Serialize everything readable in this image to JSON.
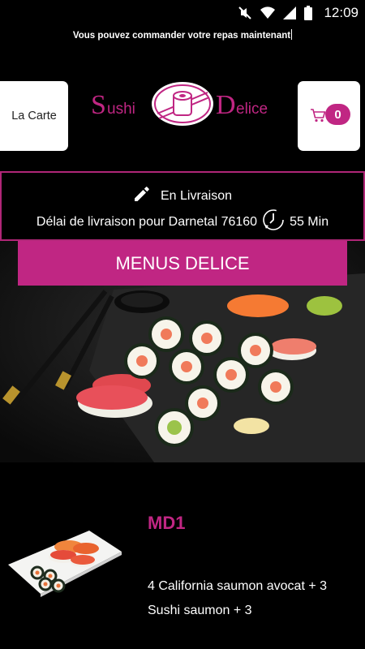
{
  "status_bar": {
    "time": "12:09"
  },
  "promo_text": "Vous pouvez commander votre repas maintenant",
  "header": {
    "menu_button_label": "La Carte",
    "logo": {
      "word1_initial": "S",
      "word1_rest": "ushi",
      "word2_initial": "D",
      "word2_rest": "elice"
    },
    "cart_count": "0"
  },
  "delivery": {
    "mode": "En Livraison",
    "area_text": "Délai de livraison pour Darnetal 76160",
    "duration": "55 Min"
  },
  "section": {
    "title": "MENUS DELICE"
  },
  "menu_item": {
    "name": "MD1",
    "description": "4 California saumon avocat + 3 Sushi saumon + 3"
  },
  "colors": {
    "brand_pink": "#c02683",
    "background": "#000000",
    "button_bg": "#ffffff"
  }
}
